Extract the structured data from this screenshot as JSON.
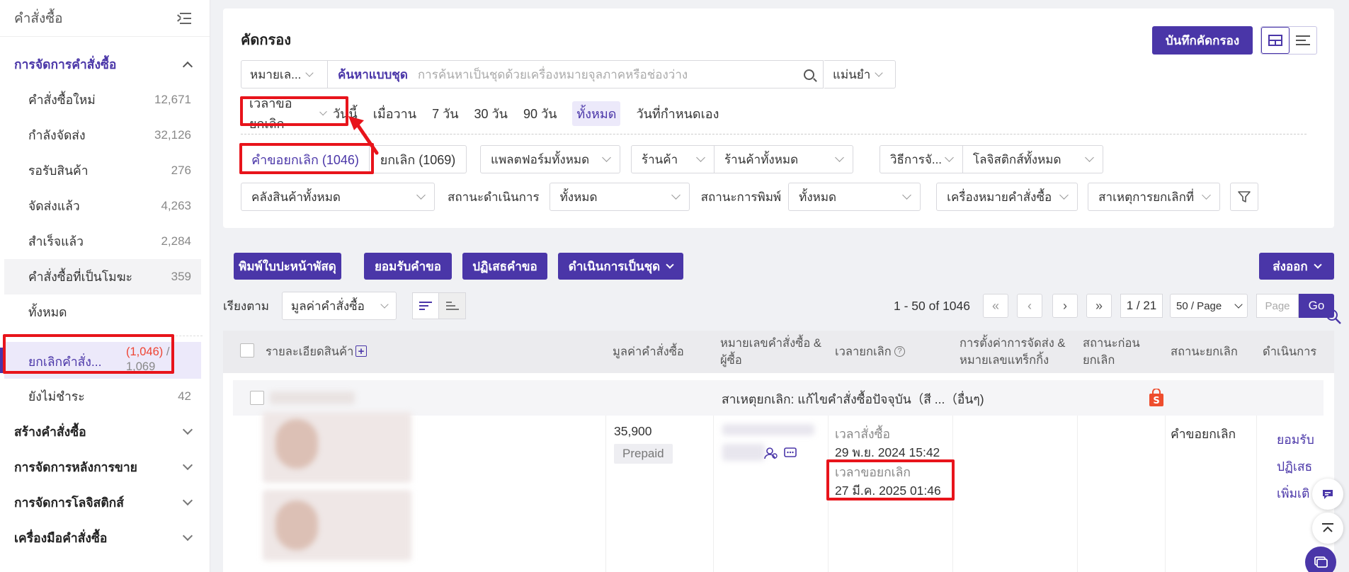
{
  "sidebar": {
    "title": "คำสั่งซื้อ",
    "active_group": "การจัดการคำสั่งซื้อ",
    "items": [
      {
        "label": "คำสั่งซื้อใหม่",
        "count": "12,671"
      },
      {
        "label": "กำลังจัดส่ง",
        "count": "32,126"
      },
      {
        "label": "รอรับสินค้า",
        "count": "276"
      },
      {
        "label": "จัดส่งแล้ว",
        "count": "4,263"
      },
      {
        "label": "สำเร็จแล้ว",
        "count": "2,284"
      },
      {
        "label": "คำสั่งซื้อที่เป็นโมฆะ",
        "count": "359"
      },
      {
        "label": "ทั้งหมด",
        "count": ""
      }
    ],
    "selected": {
      "label": "ยกเลิกคำสั่ง...",
      "count_red": "(1,046)",
      "count_rest": " / 1,069"
    },
    "unpaid": {
      "label": "ยังไม่ชำระ",
      "count": "42"
    },
    "groups": [
      "สร้างคำสั่งซื้อ",
      "การจัดการหลังการขาย",
      "การจัดการโลจิสติกส์",
      "เครื่องมือคำสั่งซื้อ"
    ]
  },
  "filter": {
    "title": "คัดกรอง",
    "save_label": "บันทึกคัดกรอง",
    "search_type": "หมายเล...",
    "search_mode": "ค้นหาแบบชุด",
    "search_placeholder": "การค้นหาเป็นชุดด้วยเครื่องหมายจุลภาคหรือช่องว่าง",
    "match": "แม่นยำ",
    "time_type": "เวลาขอยกเลิก",
    "time_options": [
      "วันนี้",
      "เมื่อวาน",
      "7 วัน",
      "30 วัน",
      "90 วัน",
      "ทั้งหมด",
      "วันที่กำหนดเอง"
    ],
    "time_selected": "ทั้งหมด",
    "tabs": [
      "คำขอยกเลิก (1046)",
      "ยกเลิก (1069)"
    ],
    "platform": "แพลตฟอร์มทั้งหมด",
    "shop_label": "ร้านค้า",
    "shop": "ร้านค้าทั้งหมด",
    "method_label": "วิธีการจั...",
    "logistics": "โลจิสติกส์ทั้งหมด",
    "warehouse": "คลังสินค้าทั้งหมด",
    "proc_label": "สถานะดำเนินการ",
    "proc": "ทั้งหมด",
    "print_label": "สถานะการพิมพ์",
    "print": "ทั้งหมด",
    "marker": "เครื่องหมายคำสั่งซื้อ",
    "reason": "สาเหตุการยกเลิกที่"
  },
  "actions": {
    "print": "พิมพ์ใบปะหน้าพัสดุ",
    "accept": "ยอมรับคำขอ",
    "reject": "ปฏิเสธคำขอ",
    "batch": "ดำเนินการเป็นชุด",
    "export": "ส่งออก"
  },
  "sort": {
    "label": "เรียงตาม",
    "value": "มูลค่าคำสั่งซื้อ",
    "range": "1 - 50 of 1046",
    "page": "1 / 21",
    "per_page": "50 / Page",
    "page_placeholder": "Page",
    "go": "Go"
  },
  "table": {
    "headers": {
      "product": "รายละเอียดสินค้า",
      "value": "มูลค่าคำสั่งซื้อ",
      "order_no_1": "หมายเลขคำสั่งซื้อ &",
      "order_no_2": "ผู้ซื้อ",
      "cancel_time": "เวลายกเลิก",
      "ship_1": "การตั้งค่าการจัดส่ง &",
      "ship_2": "หมายเลขแทร็กกิ้ง",
      "pre_1": "สถานะก่อน",
      "pre_2": "ยกเลิก",
      "cancel_status": "สถานะยกเลิก",
      "ops": "ดำเนินการ"
    },
    "row": {
      "reason": "สาเหตุยกเลิก: แก้ไขคำสั่งซื้อปัจจุบัน（สี ...（อื่นๆ)",
      "value": "35,900",
      "payment": "Prepaid",
      "order_time_label": "เวลาสั่งซื้อ",
      "order_time": "29 พ.ย. 2024 15:42",
      "req_time_label": "เวลาขอยกเลิก",
      "req_time": "27 มี.ค. 2025 01:46",
      "status": "คำขอยกเลิก",
      "actions": [
        "ยอมรับ",
        "ปฏิเสธ",
        "เพิ่มเติ"
      ]
    }
  },
  "colors": {
    "accent": "#4a36a8",
    "highlight": "#e8141b",
    "shopee": "#ee4d2d"
  }
}
